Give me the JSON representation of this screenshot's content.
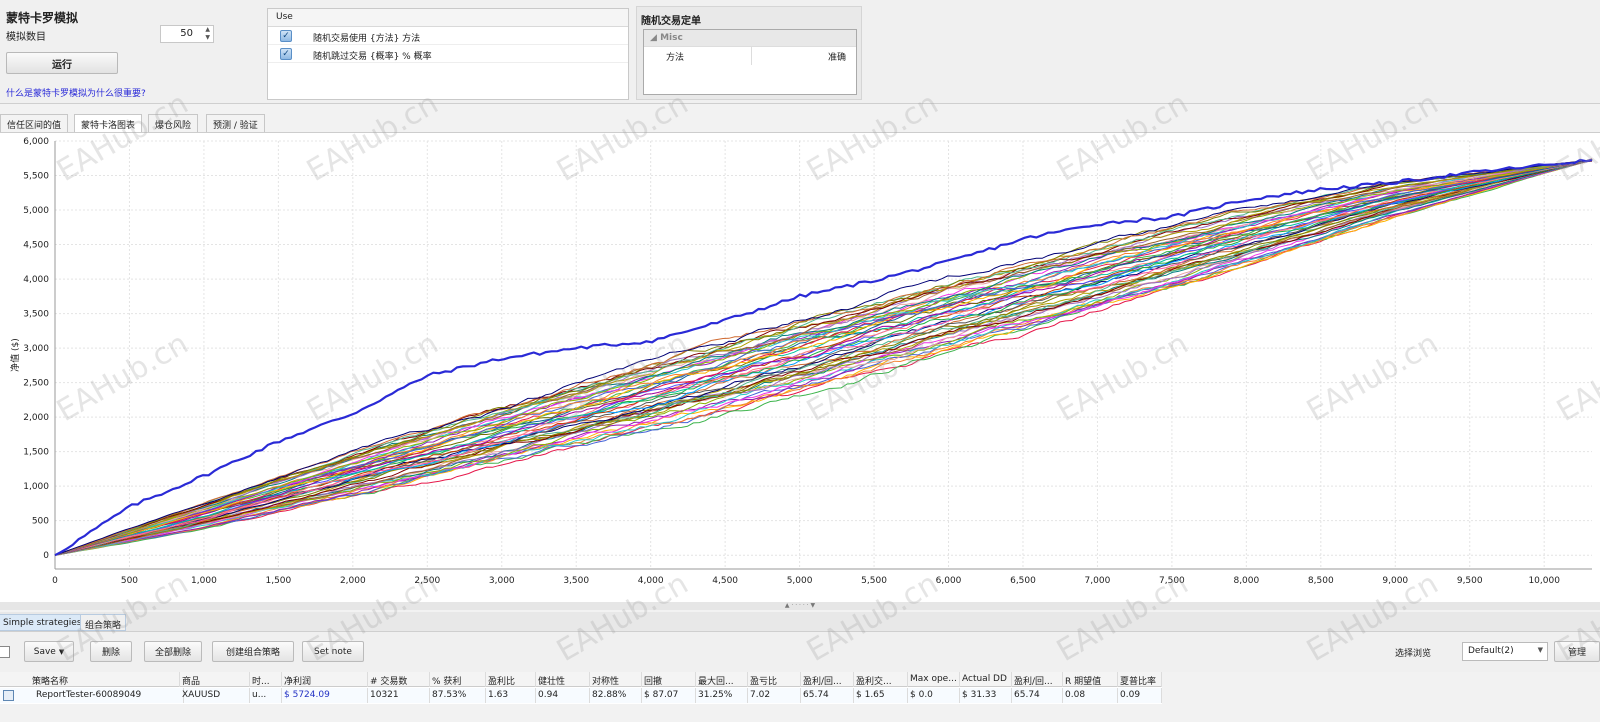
{
  "settings": {
    "title": "蒙特卡罗模拟",
    "sim_count_label": "模拟数目",
    "sim_count": "50",
    "run_label": "运行",
    "why_link": "什么是蒙特卡罗模拟为什么很重要?"
  },
  "use_panel": {
    "header": "Use",
    "rows": [
      {
        "checked": true,
        "label": "随机交易使用 {方法} 方法"
      },
      {
        "checked": true,
        "label": "随机跳过交易 {概率} % 概率"
      }
    ]
  },
  "random_panel": {
    "title": "随机交易定单",
    "category": "Misc",
    "rows": [
      {
        "key": "方法",
        "value": "准确"
      }
    ]
  },
  "tabs": [
    {
      "label": "信任区间的值",
      "active": false
    },
    {
      "label": "蒙特卡洛图表",
      "active": true
    },
    {
      "label": "爆仓风险",
      "active": false
    },
    {
      "label": "预测 / 验证",
      "active": false
    }
  ],
  "chart_data": {
    "type": "line",
    "ylabel": "净值 ($)",
    "xlim": [
      0,
      10321
    ],
    "ylim": [
      -200,
      6000
    ],
    "xticks": [
      0,
      500,
      1000,
      1500,
      2000,
      2500,
      3000,
      3500,
      4000,
      4500,
      5000,
      5500,
      6000,
      6500,
      7000,
      7500,
      8000,
      8500,
      9000,
      9500,
      10000
    ],
    "xtick_labels": [
      "0",
      "500",
      "1,000",
      "1,500",
      "2,000",
      "2,500",
      "3,000",
      "3,500",
      "4,000",
      "4,500",
      "5,000",
      "5,500",
      "6,000",
      "6,500",
      "7,000",
      "7,500",
      "8,000",
      "8,500",
      "9,000",
      "9,500",
      "10,000"
    ],
    "yticks": [
      0,
      500,
      1000,
      1500,
      2000,
      2500,
      3000,
      3500,
      4000,
      4500,
      5000,
      5500,
      6000
    ],
    "ytick_labels": [
      "0",
      "500",
      "1,000",
      "1,500",
      "2,000",
      "2,500",
      "3,000",
      "3,500",
      "4,000",
      "4,500",
      "5,000",
      "5,500",
      "6,000"
    ],
    "grid": true,
    "series_count": 50,
    "end_value": 5724.09,
    "highlight_series": {
      "color": "#2a2ad6",
      "x": [
        0,
        500,
        1000,
        1500,
        2000,
        2500,
        3000,
        3500,
        4000,
        4500,
        5000,
        5500,
        6000,
        6500,
        7000,
        7500,
        8000,
        8500,
        9000,
        9500,
        10000,
        10321
      ],
      "y": [
        0,
        700,
        1150,
        1650,
        2050,
        2600,
        2850,
        3000,
        3100,
        3400,
        3750,
        3980,
        4250,
        4580,
        4800,
        4900,
        5150,
        5300,
        5400,
        5540,
        5650,
        5724
      ]
    },
    "envelope": {
      "x": [
        0,
        1000,
        2000,
        3000,
        4000,
        5000,
        6000,
        7000,
        8000,
        9000,
        10000,
        10321
      ],
      "upper": [
        0,
        750,
        1500,
        2150,
        2800,
        3400,
        3980,
        4500,
        5000,
        5400,
        5650,
        5724
      ],
      "lower": [
        0,
        380,
        850,
        1330,
        1820,
        2350,
        2950,
        3550,
        4200,
        4900,
        5530,
        5724
      ]
    },
    "palette": [
      "#e6194b",
      "#3cb44b",
      "#ffb400",
      "#4363d8",
      "#f58231",
      "#911eb4",
      "#22c7c7",
      "#f032e6",
      "#8ab300",
      "#e8a0a0",
      "#008080",
      "#9a6dc4",
      "#9a6324",
      "#b0a000",
      "#800000",
      "#4fb890",
      "#808000",
      "#d06a30",
      "#000075",
      "#555555",
      "#00a0ff",
      "#ff4fa0",
      "#20b040",
      "#c04000",
      "#5050ff",
      "#ff8080",
      "#00c0a0",
      "#a000a0",
      "#707000",
      "#1060a0"
    ]
  },
  "bottom_tabs": [
    {
      "label": "Simple strategies",
      "active": true
    },
    {
      "label": "组合策略",
      "active": false
    }
  ],
  "toolbar": {
    "save": "Save",
    "delete": "删除",
    "delete_all": "全部删除",
    "create_combo": "创建组合策略",
    "set_note": "Set note",
    "view_label": "选择浏览",
    "view_value": "Default(2)",
    "manage": "管理"
  },
  "table": {
    "headers": [
      "策略名称",
      "商品",
      "时...",
      "净利润",
      "# 交易数",
      "% 获利",
      "盈利比",
      "健壮性",
      "对称性",
      "回撤",
      "最大回...",
      "盈亏比",
      "盈利/回...",
      "盈利交...",
      "Max ope...",
      "Actual DD",
      "盈利/回...",
      "R 期望值",
      "夏普比率"
    ],
    "rows": [
      [
        "ReportTester-60089049",
        "XAUUSD",
        "u...",
        "$ 5724.09",
        "10321",
        "87.53%",
        "1.63",
        "0.94",
        "82.88%",
        "$ 87.07",
        "31.25%",
        "7.02",
        "65.74",
        "$ 1.65",
        "$ 0.0",
        "$ 31.33",
        "65.74",
        "0.08",
        "0.09"
      ]
    ]
  },
  "watermark": "EAHub.cn"
}
